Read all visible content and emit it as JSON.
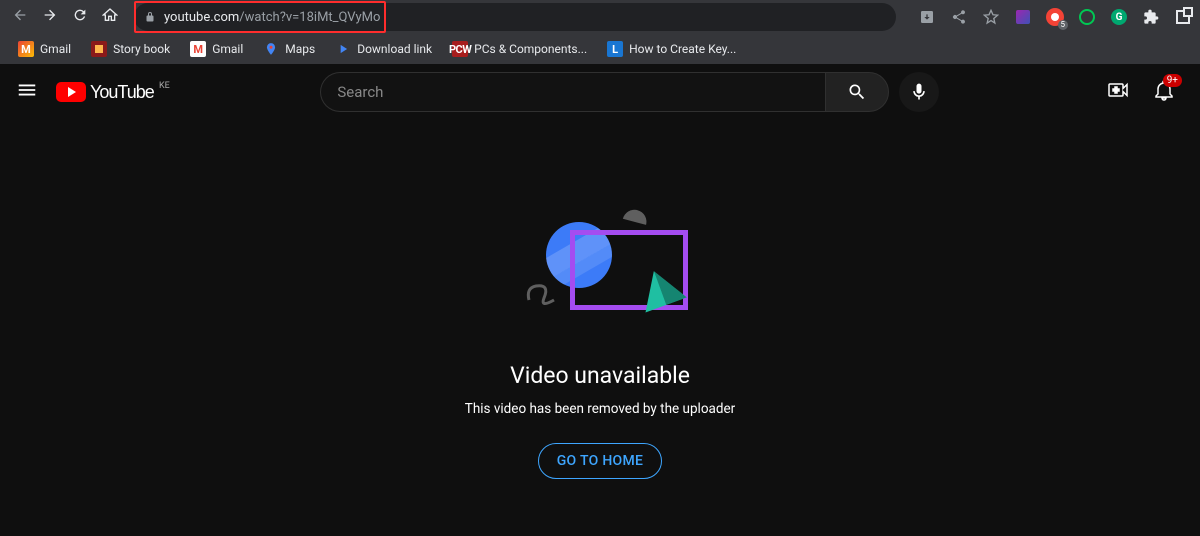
{
  "browser": {
    "url_host": "youtube.com",
    "url_path": "/watch?v=18iMt_QVyMo",
    "ext_red_badge": "5",
    "ext_g_letter": "G",
    "bookmarks": [
      {
        "label": "Gmail"
      },
      {
        "label": "Story book"
      },
      {
        "label": "Gmail"
      },
      {
        "label": "Maps"
      },
      {
        "label": "Download link"
      },
      {
        "label": "PCs & Components..."
      },
      {
        "label": "How to Create Key..."
      }
    ]
  },
  "youtube": {
    "logo_text": "YouTube",
    "country_code": "KE",
    "search_placeholder": "Search",
    "notification_badge": "9+"
  },
  "error": {
    "title": "Video unavailable",
    "subtitle": "This video has been removed by the uploader",
    "home_button": "GO TO HOME"
  }
}
